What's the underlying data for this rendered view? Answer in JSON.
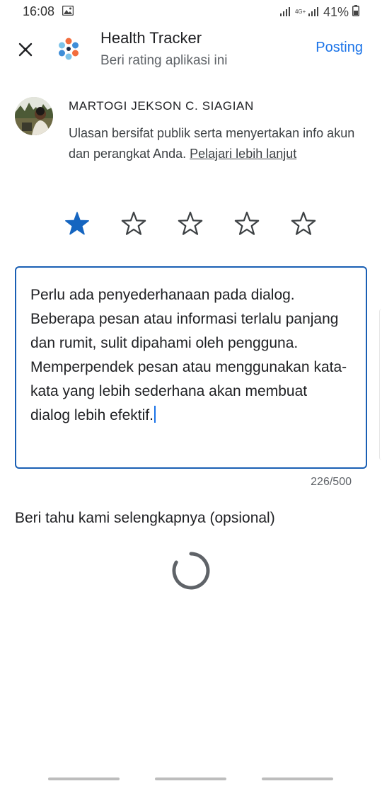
{
  "status_bar": {
    "time": "16:08",
    "network": "4G+",
    "battery": "41%"
  },
  "header": {
    "app_title": "Health Tracker",
    "subtitle": "Beri rating aplikasi ini",
    "post_label": "Posting"
  },
  "user": {
    "name": "MARTOGI JEKSON C. SIAGIAN",
    "disclaimer": "Ulasan bersifat publik serta menyertakan info akun dan perangkat Anda.",
    "learn_more": "Pelajari lebih lanjut"
  },
  "rating": {
    "value": 1,
    "max": 5
  },
  "review": {
    "text": "Perlu ada penyederhanaan pada dialog. Beberapa pesan atau informasi terlalu panjang dan rumit, sulit dipahami oleh pengguna. Memperpendek pesan atau menggunakan kata-kata yang lebih sederhana akan membuat dialog lebih efektif.",
    "char_count": "226/500"
  },
  "more_section": {
    "label": "Beri tahu kami selengkapnya (opsional)"
  },
  "colors": {
    "accent": "#1a73e8",
    "star_filled": "#1565c0",
    "star_empty": "#3c4043",
    "border": "#1a5fb4"
  },
  "icons": {
    "close": "close-icon",
    "star_filled": "star-filled-icon",
    "star_outline": "star-outline-icon",
    "loading": "loading-spinner-icon"
  }
}
